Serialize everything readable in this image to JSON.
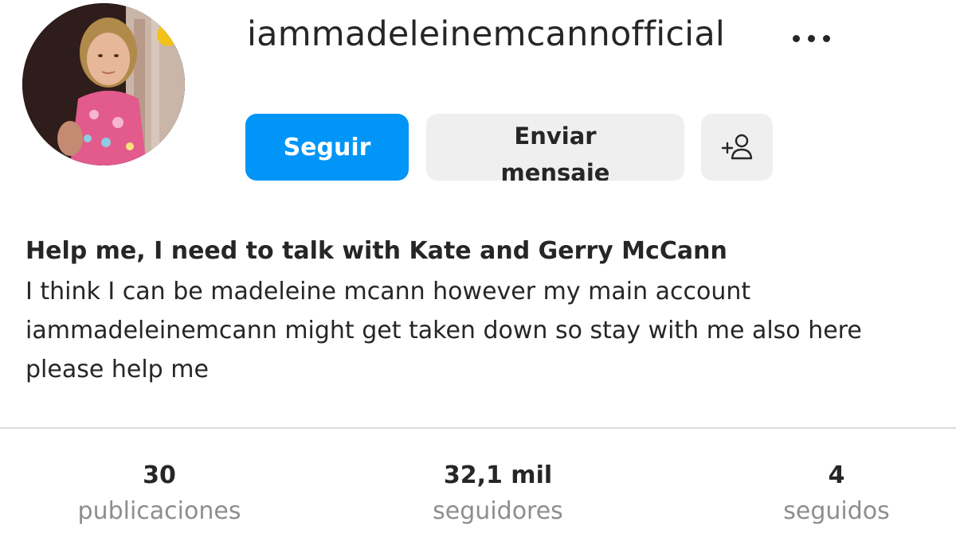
{
  "profile": {
    "username": "iammadeleinemcannofficial",
    "avatar_icon": "profile-photo"
  },
  "actions": {
    "follow_label": "Seguir",
    "message_label": "Enviar mensaje",
    "add_user_icon": "add-person-icon",
    "more_icon": "more-options-icon"
  },
  "bio": {
    "name": "Help me, I need to talk with Kate and Gerry McCann",
    "text": "I think I can be madeleine mcann however my main account iammadeleinemcann might get taken down so stay with me also here please help me"
  },
  "stats": {
    "posts": {
      "value": "30",
      "label": "publicaciones"
    },
    "followers": {
      "value": "32,1 mil",
      "label": "seguidores"
    },
    "following": {
      "value": "4",
      "label": "seguidos"
    }
  },
  "colors": {
    "accent": "#0095f6",
    "button_secondary": "#efefef",
    "text_primary": "#262626",
    "text_secondary": "#8e8e8e",
    "divider": "#dbdbdb"
  }
}
